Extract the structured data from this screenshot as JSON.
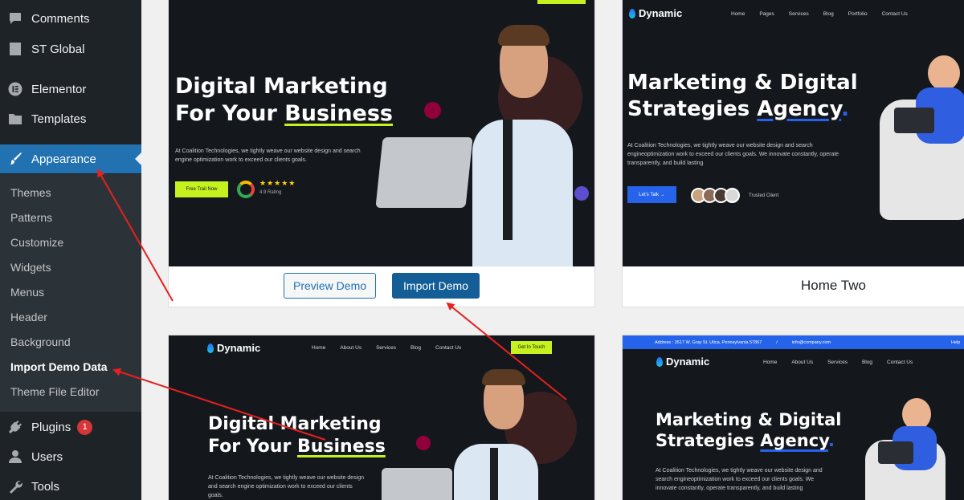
{
  "sidebar": {
    "items": [
      {
        "label": "Comments",
        "icon": "comment-icon"
      },
      {
        "label": "ST Global",
        "icon": "document-icon"
      },
      {
        "label": "Elementor",
        "icon": "elementor-icon"
      },
      {
        "label": "Templates",
        "icon": "folder-icon"
      },
      {
        "label": "Appearance",
        "icon": "paintbrush-icon"
      },
      {
        "label": "Plugins",
        "icon": "plug-icon",
        "badge": "1"
      },
      {
        "label": "Users",
        "icon": "user-icon"
      },
      {
        "label": "Tools",
        "icon": "wrench-icon"
      }
    ],
    "submenu": [
      "Themes",
      "Patterns",
      "Customize",
      "Widgets",
      "Menus",
      "Header",
      "Background",
      "Import Demo Data",
      "Theme File Editor"
    ],
    "current_submenu": "Import Demo Data",
    "active_color": "#2271b1"
  },
  "cards": {
    "card1": {
      "hero_line1": "Digital Marketing",
      "hero_line2_pre": "For Your ",
      "hero_line2_hl": "Business",
      "desc": "At Coalition Technologies, we tightly weave our website design and search engine optimization work to exceed our clients goals.",
      "cta": "Free Trail Now",
      "rating": "4.9 Rating",
      "preview_label": "Preview Demo",
      "import_label": "Import Demo"
    },
    "card2": {
      "logo": "Dynamic",
      "nav": [
        "Home",
        "Pages",
        "Services",
        "Blog",
        "Portfolio",
        "Contact Us"
      ],
      "hero_line1": "Marketing & Digital",
      "hero_line2_pre": "Strategies ",
      "hero_line2_hl": "Agency",
      "hero_dot": ".",
      "desc": "At Coalition Technologies, we tightly weave our website design and search engineoptimization work to exceed our clients goals. We innovate constantly, operate transparently, and build lasting",
      "cta": "Let's Talk →",
      "trusted": "Trusted Client",
      "name": "Home Two"
    },
    "card3": {
      "logo": "Dynamic",
      "nav": [
        "Home",
        "About Us",
        "Services",
        "Blog",
        "Contact Us"
      ],
      "nav_cta": "Get In Touch",
      "hero_line1": "Digital Marketing",
      "hero_line2_pre": "For Your ",
      "hero_line2_hl": "Business",
      "desc": "At Coalition Technologies, we tightly weave our website design and search engine optimization work to exceed our clients goals."
    },
    "card4": {
      "topbar_address": "Address : 3517 W. Gray St. Utica, Pennsylvania 57867",
      "topbar_email": "info@company.com",
      "topbar_help": "Help",
      "logo": "Dynamic",
      "nav": [
        "Home",
        "About Us",
        "Services",
        "Blog",
        "Contact Us"
      ],
      "hero_line1": "Marketing & Digital",
      "hero_line2_pre": "Strategies ",
      "hero_line2_hl": "Agency",
      "hero_dot": ".",
      "desc": "At Coalition Technologies, we tightly weave our website design and search engineoptimization work to exceed our clients goals. We innovate constantly, operate transparently, and build lasting"
    }
  },
  "annotation_color": "#e8201e"
}
